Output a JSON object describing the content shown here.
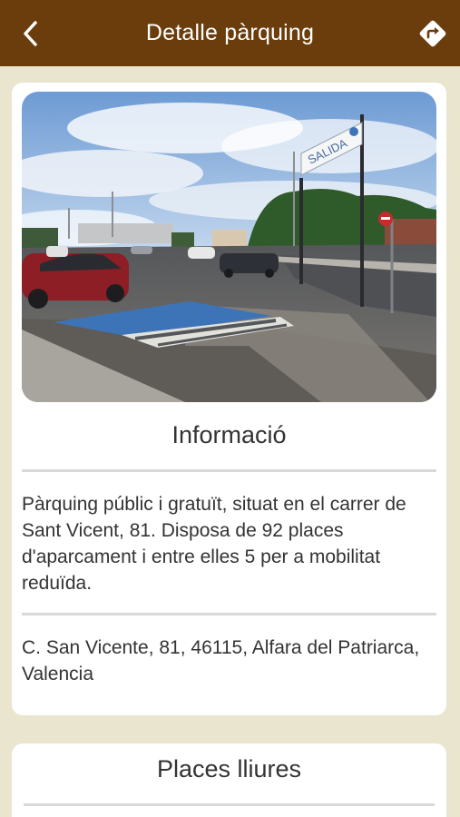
{
  "header": {
    "title": "Detalle pàrquing",
    "back_icon": "chevron-left-icon",
    "directions_icon": "directions-icon",
    "color": "#6b3d0c"
  },
  "info": {
    "photo_sign_text": "SALIDA",
    "heading": "Informació",
    "description": "Pàrquing públic i gratuït, situat en el carrer de Sant Vicent, 81. Disposa de 92 places d'aparcament i entre elles 5 per a mobilitat reduïda.",
    "address": "C. San Vicente, 81, 46115, Alfara del Patriarca, Valencia"
  },
  "places": {
    "heading": "Places lliures"
  },
  "colors": {
    "background": "#e9e5cf",
    "card": "#ffffff",
    "divider": "#d9d9d9"
  }
}
